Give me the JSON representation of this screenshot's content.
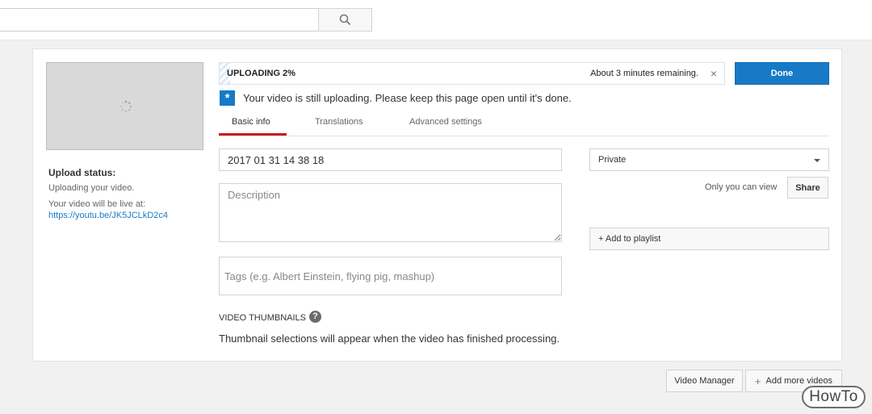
{
  "search": {
    "value": "",
    "placeholder": "",
    "icon": "search-icon"
  },
  "upload": {
    "status_title": "Upload status:",
    "status_text": "Uploading your video.",
    "live_label": "Your video will be live at:",
    "live_link": "https://youtu.be/JK5JCLkD2c4",
    "progress_label": "UPLOADING 2%",
    "progress_fraction": 0.02,
    "remaining": "About 3 minutes remaining.",
    "close_glyph": "×",
    "done_label": "Done"
  },
  "notice": {
    "icon_glyph": "*",
    "text": "Your video is still uploading. Please keep this page open until it's done."
  },
  "tabs": [
    {
      "label": "Basic info",
      "active": true
    },
    {
      "label": "Translations",
      "active": false
    },
    {
      "label": "Advanced settings",
      "active": false
    }
  ],
  "form": {
    "title_value": "2017 01 31 14 38 18",
    "description_placeholder": "Description",
    "tags_placeholder": "Tags (e.g. Albert Einstein, flying pig, mashup)",
    "thumbnails_title": "VIDEO THUMBNAILS",
    "help_glyph": "?",
    "thumbnails_text": "Thumbnail selections will appear when the video has finished processing."
  },
  "privacy": {
    "selected": "Private",
    "hint": "Only you can view",
    "share_label": "Share",
    "playlist_label": "+ Add to playlist"
  },
  "footer": {
    "video_manager_label": "Video Manager",
    "add_more_plus": "+",
    "add_more_label": "Add more videos"
  },
  "watermark": "HowTo",
  "colors": {
    "accent": "#167ac6",
    "tab_underline": "#cc181e",
    "progress_stripe": "#dcecf8"
  }
}
